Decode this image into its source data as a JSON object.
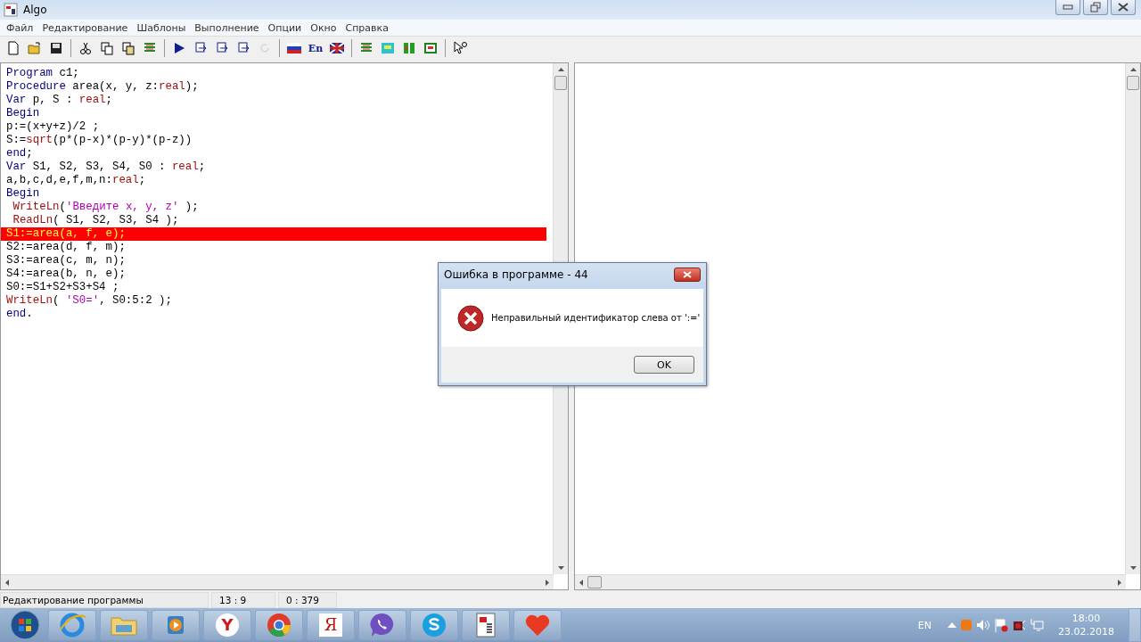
{
  "window": {
    "title": "Algo"
  },
  "menu": [
    "Файл",
    "Редактирование",
    "Шаблоны",
    "Выполнение",
    "Опции",
    "Окно",
    "Справка"
  ],
  "toolbar": [
    {
      "kind": "new"
    },
    {
      "kind": "open"
    },
    {
      "kind": "save"
    },
    {
      "kind": "sep"
    },
    {
      "kind": "cut"
    },
    {
      "kind": "copy"
    },
    {
      "kind": "paste"
    },
    {
      "kind": "list"
    },
    {
      "kind": "sep"
    },
    {
      "kind": "run"
    },
    {
      "kind": "step-in"
    },
    {
      "kind": "step-over"
    },
    {
      "kind": "trace"
    },
    {
      "kind": "reset",
      "disabled": true
    },
    {
      "kind": "sep"
    },
    {
      "kind": "flag-ru"
    },
    {
      "kind": "text",
      "label": "En"
    },
    {
      "kind": "flag-uk"
    },
    {
      "kind": "sep"
    },
    {
      "kind": "list"
    },
    {
      "kind": "panel"
    },
    {
      "kind": "split"
    },
    {
      "kind": "window"
    },
    {
      "kind": "sep"
    },
    {
      "kind": "help"
    }
  ],
  "editor": {
    "lines": [
      {
        "highlighted": false,
        "tokens": [
          {
            "kind": "keyword",
            "text": "Program"
          },
          {
            "kind": "plain",
            "text": " c1;"
          }
        ]
      },
      {
        "highlighted": false,
        "tokens": [
          {
            "kind": "keyword",
            "text": "Procedure"
          },
          {
            "kind": "plain",
            "text": " area(x, y, z:"
          },
          {
            "kind": "type",
            "text": "real"
          },
          {
            "kind": "plain",
            "text": ");"
          }
        ]
      },
      {
        "highlighted": false,
        "tokens": [
          {
            "kind": "keyword",
            "text": "Var"
          },
          {
            "kind": "plain",
            "text": " p, S : "
          },
          {
            "kind": "type",
            "text": "real"
          },
          {
            "kind": "plain",
            "text": ";"
          }
        ]
      },
      {
        "highlighted": false,
        "tokens": [
          {
            "kind": "keyword",
            "text": "Begin"
          }
        ]
      },
      {
        "highlighted": false,
        "tokens": [
          {
            "kind": "plain",
            "text": "p:=(x+y+z)/2 ;"
          }
        ]
      },
      {
        "highlighted": false,
        "tokens": [
          {
            "kind": "plain",
            "text": "S:="
          },
          {
            "kind": "func",
            "text": "sqrt"
          },
          {
            "kind": "plain",
            "text": "(p*(p-x)*(p-y)*(p-z))"
          }
        ]
      },
      {
        "highlighted": false,
        "tokens": [
          {
            "kind": "keyword",
            "text": "end"
          },
          {
            "kind": "plain",
            "text": ";"
          }
        ]
      },
      {
        "highlighted": false,
        "tokens": [
          {
            "kind": "keyword",
            "text": "Var"
          },
          {
            "kind": "plain",
            "text": " S1, S2, S3, S4, S0 : "
          },
          {
            "kind": "type",
            "text": "real"
          },
          {
            "kind": "plain",
            "text": ";"
          }
        ]
      },
      {
        "highlighted": false,
        "tokens": [
          {
            "kind": "plain",
            "text": "a,b,c,d,e,f,m,n:"
          },
          {
            "kind": "type",
            "text": "real"
          },
          {
            "kind": "plain",
            "text": ";"
          }
        ]
      },
      {
        "highlighted": false,
        "tokens": [
          {
            "kind": "keyword",
            "text": "Begin"
          }
        ]
      },
      {
        "highlighted": false,
        "indented": true,
        "tokens": [
          {
            "kind": "func",
            "text": "WriteLn"
          },
          {
            "kind": "plain",
            "text": "("
          },
          {
            "kind": "string",
            "text": "'Введите x, y, z'"
          },
          {
            "kind": "plain",
            "text": " );"
          }
        ]
      },
      {
        "highlighted": false,
        "indented": true,
        "tokens": [
          {
            "kind": "func",
            "text": "ReadLn"
          },
          {
            "kind": "plain",
            "text": "( S1, S2, S3, S4 );"
          }
        ]
      },
      {
        "highlighted": true,
        "tokens": [
          {
            "kind": "plain",
            "text": "S1:=area(a, f, e);"
          }
        ]
      },
      {
        "highlighted": false,
        "tokens": [
          {
            "kind": "plain",
            "text": "S2:=area(d, f, m);"
          }
        ]
      },
      {
        "highlighted": false,
        "tokens": [
          {
            "kind": "plain",
            "text": "S3:=area(c, m, n);"
          }
        ]
      },
      {
        "highlighted": false,
        "tokens": [
          {
            "kind": "plain",
            "text": "S4:=area(b, n, e);"
          }
        ]
      },
      {
        "highlighted": false,
        "tokens": [
          {
            "kind": "plain",
            "text": "S0:=S1+S2+S3+S4 ;"
          }
        ]
      },
      {
        "highlighted": false,
        "tokens": [
          {
            "kind": "func",
            "text": "WriteLn"
          },
          {
            "kind": "plain",
            "text": "( "
          },
          {
            "kind": "string",
            "text": "'S0='"
          },
          {
            "kind": "plain",
            "text": ", S0:5:2 );"
          }
        ]
      },
      {
        "highlighted": false,
        "tokens": [
          {
            "kind": "keyword",
            "text": "end"
          },
          {
            "kind": "plain",
            "text": "."
          }
        ]
      }
    ]
  },
  "dialog": {
    "title": "Ошибка в программе -  44",
    "message": "Неправильный идентификатор слева от ':='",
    "button": "OK"
  },
  "status_bar": [
    "Редактирование программы",
    "13 :  9",
    "0 : 379"
  ],
  "taskbar": {
    "apps": [
      {
        "kind": "ie"
      },
      {
        "kind": "folder"
      },
      {
        "kind": "media"
      },
      {
        "kind": "letter",
        "label": "Y",
        "color": "#d01818"
      },
      {
        "kind": "chrome"
      },
      {
        "kind": "tag",
        "label": "Я",
        "color": "#c01010"
      },
      {
        "kind": "viber"
      },
      {
        "kind": "skype"
      },
      {
        "kind": "algo"
      },
      {
        "kind": "heart"
      }
    ],
    "language": "EN",
    "clock": {
      "time": "18:00",
      "date": "23.02.2018"
    }
  }
}
